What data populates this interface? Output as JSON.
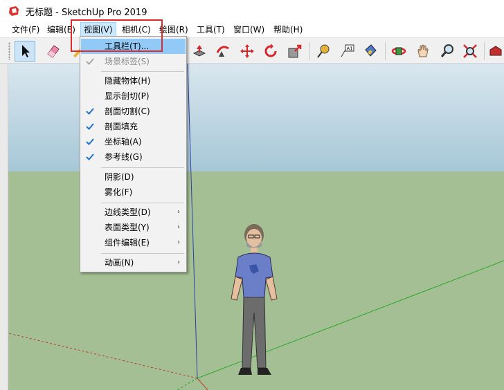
{
  "window": {
    "title": "无标题 - SketchUp Pro 2019",
    "icon": "sketchup-logo-icon"
  },
  "menubar": {
    "items": [
      {
        "label": "文件(F)"
      },
      {
        "label": "编辑(E)"
      },
      {
        "label": "视图(V)"
      },
      {
        "label": "相机(C)"
      },
      {
        "label": "绘图(R)"
      },
      {
        "label": "工具(T)"
      },
      {
        "label": "窗口(W)"
      },
      {
        "label": "帮助(H)"
      }
    ],
    "active": "视图(V)"
  },
  "toolbar": {
    "tools": [
      "select-arrow-icon",
      "eraser-icon",
      "push-pull-icon",
      "follow-me-icon",
      "move-icon",
      "rotate-icon",
      "scale-icon",
      "tape-measure-icon",
      "text-icon",
      "paint-bucket-icon",
      "orbit-icon",
      "pan-icon",
      "zoom-icon",
      "zoom-extents-icon",
      "warehouse-icon"
    ],
    "selected": "select-arrow-icon"
  },
  "view_menu": {
    "items": [
      {
        "label": "工具栏(T)...",
        "highlighted": true
      },
      {
        "label": "场景标签(S)",
        "checked": true,
        "disabled": true
      },
      {
        "label": "隐藏物体(H)"
      },
      {
        "label": "显示剖切(P)"
      },
      {
        "label": "剖面切割(C)",
        "checked": true
      },
      {
        "label": "剖面填充",
        "checked": true
      },
      {
        "label": "坐标轴(A)",
        "checked": true
      },
      {
        "label": "参考线(G)",
        "checked": true
      },
      {
        "label": "阴影(D)"
      },
      {
        "label": "雾化(F)"
      },
      {
        "label": "边线类型(D)",
        "submenu": true
      },
      {
        "label": "表面类型(Y)",
        "submenu": true
      },
      {
        "label": "组件编辑(E)",
        "submenu": true
      },
      {
        "label": "动画(N)",
        "submenu": true
      }
    ],
    "submenu_arrow": "›"
  },
  "colors": {
    "highlight": "#91c9f7",
    "sky_top": "#d9e7ef",
    "sky_bottom": "#a7c7d6",
    "ground": "#a3bf93",
    "annotation_red": "#e02a2a",
    "axis_red": "#c0392b",
    "axis_green": "#2ea82e",
    "axis_blue": "#2b3fa8"
  }
}
